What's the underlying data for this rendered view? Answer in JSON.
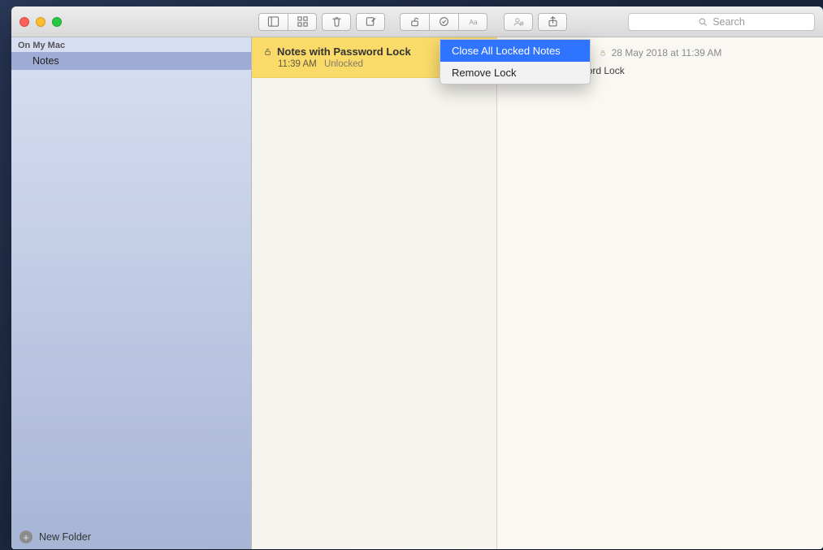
{
  "toolbar": {
    "search_placeholder": "Search"
  },
  "sidebar": {
    "section": "On My Mac",
    "items": [
      {
        "label": "Notes"
      }
    ],
    "new_folder": "New Folder"
  },
  "notelist": {
    "items": [
      {
        "title": "Notes with Password Lock",
        "time": "11:39 AM",
        "status": "Unlocked"
      }
    ]
  },
  "editor": {
    "timestamp": "28 May 2018 at 11:39 AM",
    "title": "Notes with Password Lock"
  },
  "menu": {
    "items": [
      {
        "label": "Close All Locked Notes",
        "highlighted": true
      },
      {
        "label": "Remove Lock",
        "highlighted": false
      }
    ]
  }
}
